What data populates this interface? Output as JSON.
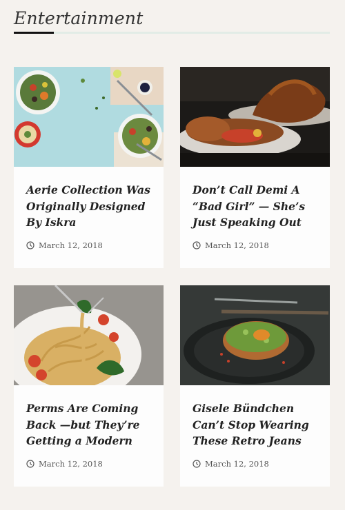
{
  "section": {
    "title": "Entertainment"
  },
  "posts": [
    {
      "title": "Aerie Collection Was Originally Designed By Iskra",
      "date": "March 12, 2018",
      "image": "salad-bowls-photo",
      "icon": "clock-icon"
    },
    {
      "title": "Don’t Call Demi A “Bad Girl” — She’s Just Speaking Out",
      "date": "March 12, 2018",
      "image": "roast-chicken-photo",
      "icon": "clock-icon"
    },
    {
      "title": "Perms Are Coming Back —but They’re Getting a Modern",
      "date": "March 12, 2018",
      "image": "pasta-plate-photo",
      "icon": "clock-icon"
    },
    {
      "title": "Gisele Bündchen Can’t Stop Wearing These Retro Jeans",
      "date": "March 12, 2018",
      "image": "avocado-toast-photo",
      "icon": "clock-icon"
    }
  ]
}
